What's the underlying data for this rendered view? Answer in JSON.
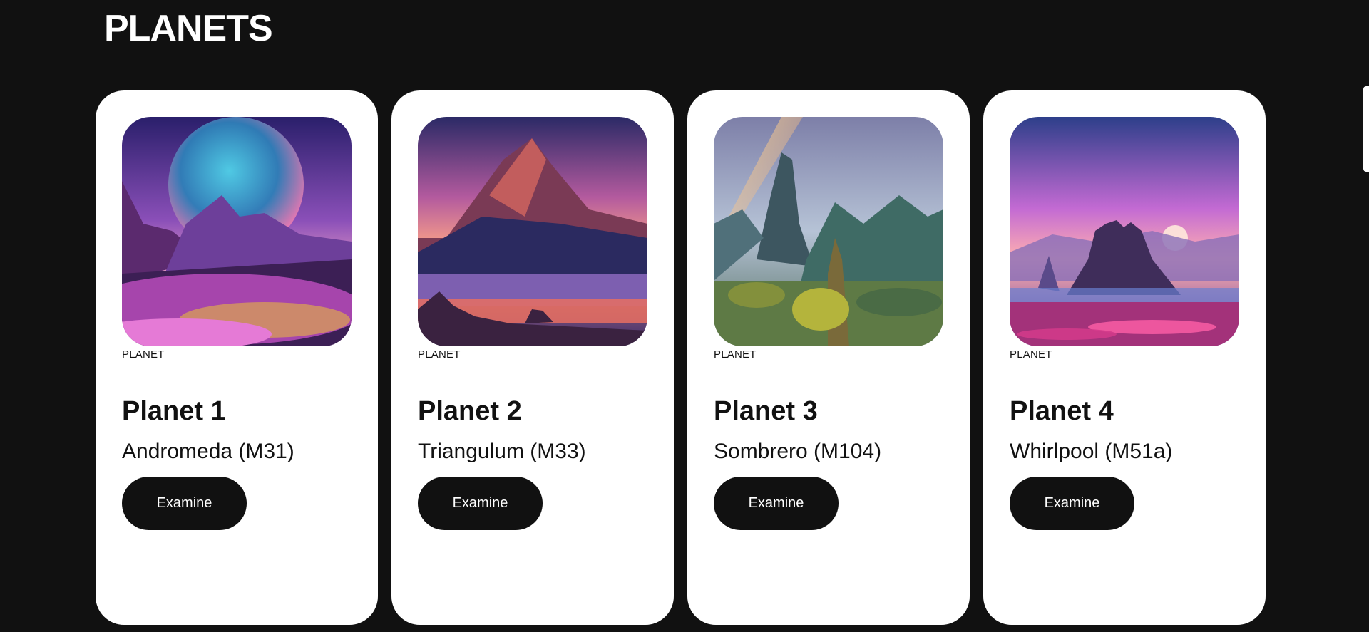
{
  "section": {
    "title": "PLANETS"
  },
  "cards": [
    {
      "category": "PLANET",
      "title": "Planet 1",
      "subtitle": "Andromeda (M31)",
      "button_label": "Examine"
    },
    {
      "category": "PLANET",
      "title": "Planet 2",
      "subtitle": "Triangulum (M33)",
      "button_label": "Examine"
    },
    {
      "category": "PLANET",
      "title": "Planet 3",
      "subtitle": "Sombrero (M104)",
      "button_label": "Examine"
    },
    {
      "category": "PLANET",
      "title": "Planet 4",
      "subtitle": "Whirlpool (M51a)",
      "button_label": "Examine"
    }
  ],
  "colors": {
    "background": "#111111",
    "card": "#ffffff",
    "button": "#111111",
    "button_text": "#ffffff"
  }
}
